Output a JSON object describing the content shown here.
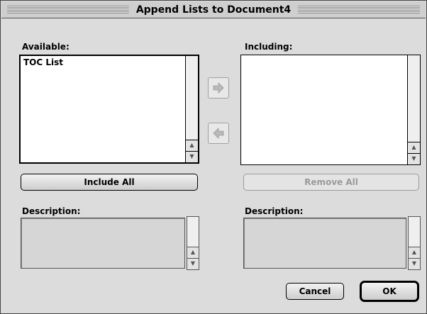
{
  "dialog": {
    "title": "Append Lists to Document4"
  },
  "available": {
    "label": "Available:",
    "items": [
      "TOC List"
    ]
  },
  "including": {
    "label": "Including:",
    "items": []
  },
  "buttons": {
    "include_all": "Include All",
    "remove_all": "Remove All",
    "cancel": "Cancel",
    "ok": "OK"
  },
  "description_left": {
    "label": "Description:",
    "text": ""
  },
  "description_right": {
    "label": "Description:",
    "text": ""
  },
  "icons": {
    "move_right": "arrow-right-icon",
    "move_left": "arrow-left-icon",
    "scroll_up": "scroll-up-arrow-icon",
    "scroll_down": "scroll-down-arrow-icon"
  },
  "colors": {
    "dialog_bg": "#dcdcdc",
    "disabled_text": "#9a9a9a"
  }
}
